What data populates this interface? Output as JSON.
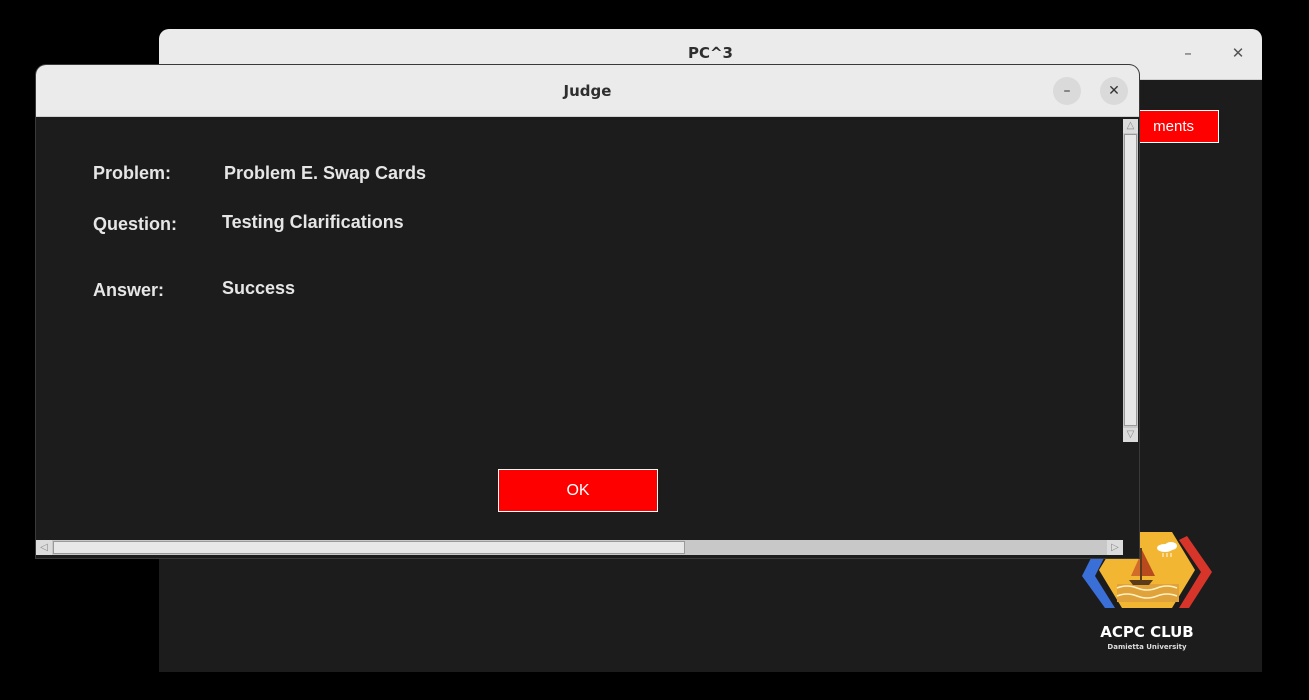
{
  "background_window": {
    "title": "PC^3",
    "minimize_glyph": "–",
    "close_glyph": "✕",
    "partial_button_label": "ments"
  },
  "logo": {
    "title": "ACPC CLUB",
    "subtitle": "Damietta University"
  },
  "dialog": {
    "title": "Judge",
    "minimize_glyph": "–",
    "close_glyph": "✕",
    "fields": {
      "problem_label": "Problem:",
      "problem_value": "Problem E. Swap Cards",
      "question_label": "Question:",
      "question_value": "Testing Clarifications",
      "answer_label": "Answer:",
      "answer_value": "Success"
    },
    "ok_label": "OK"
  },
  "colors": {
    "accent_red": "#ff0000",
    "dialog_bg": "#1c1c1c",
    "titlebar_bg": "#ebebeb"
  },
  "icons": {
    "scroll_up": "△",
    "scroll_down": "▽",
    "scroll_left": "◁",
    "scroll_right": "▷"
  }
}
